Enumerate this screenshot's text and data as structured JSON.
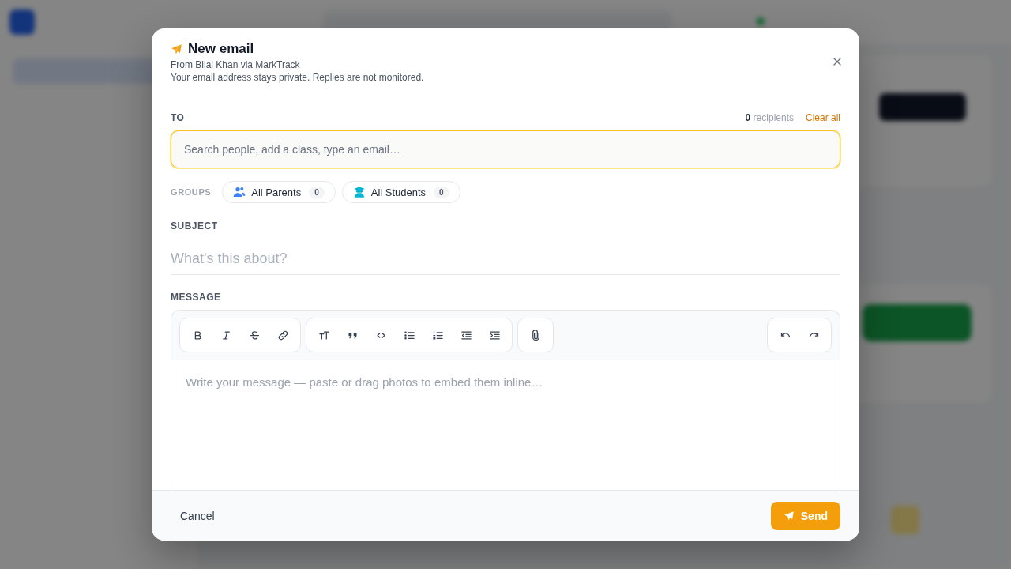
{
  "dialog": {
    "title": "New email",
    "from": "From Bilal Khan via MarkTrack",
    "note": "Your email address stays private. Replies are not monitored."
  },
  "to": {
    "label": "TO",
    "count": "0",
    "count_suffix": "recipients",
    "clear_all": "Clear all",
    "placeholder": "Search people, add a class, type an email…",
    "focused": true
  },
  "groups": {
    "label": "GROUPS",
    "items": [
      {
        "kind": "parents",
        "label": "All Parents",
        "count": "0"
      },
      {
        "kind": "students",
        "label": "All Students",
        "count": "0"
      }
    ]
  },
  "subject": {
    "label": "SUBJECT",
    "placeholder": "What's this about?"
  },
  "message": {
    "label": "MESSAGE",
    "toolbar_groups": [
      [
        {
          "kind": "bold"
        },
        {
          "kind": "italic"
        },
        {
          "kind": "strike"
        },
        {
          "kind": "link"
        }
      ],
      [
        {
          "kind": "heading"
        },
        {
          "kind": "quote"
        },
        {
          "kind": "code"
        },
        {
          "kind": "bullets"
        },
        {
          "kind": "numbers"
        },
        {
          "kind": "outdent"
        },
        {
          "kind": "indent"
        }
      ],
      [
        {
          "kind": "attach"
        }
      ]
    ],
    "history": [
      {
        "kind": "undo"
      },
      {
        "kind": "redo"
      }
    ],
    "placeholder": "Write your message — paste or drag photos to embed them inline…"
  },
  "footer": {
    "cancel": "Cancel",
    "send": "Send"
  }
}
